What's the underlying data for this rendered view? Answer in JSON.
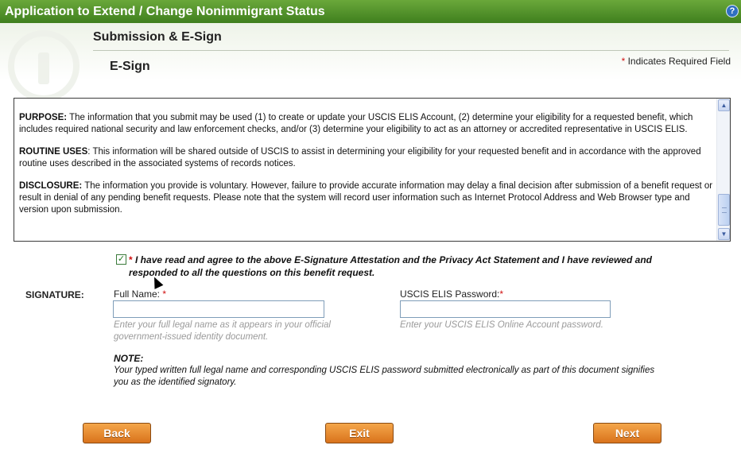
{
  "window": {
    "title": "Application to Extend / Change Nonimmigrant Status",
    "help_glyph": "?"
  },
  "header": {
    "section_title": "Submission & E-Sign",
    "sub_title": "E-Sign",
    "required_star": "*",
    "required_note": "Indicates Required Field"
  },
  "privacy": {
    "paragraphs": [
      {
        "heading": "PURPOSE:",
        "text": " The information that you submit may be used (1) to create or update your USCIS ELIS Account, (2) determine your eligibility for a requested benefit, which includes required national security and law enforcement checks, and/or (3) determine your eligibility to act as an attorney or accredited representative in USCIS ELIS."
      },
      {
        "heading": "ROUTINE USES",
        "text": ": This information will be shared outside of USCIS to assist in determining your eligibility for your requested benefit and in accordance with the approved routine uses described in the associated systems of records notices."
      },
      {
        "heading": "DISCLOSURE:",
        "text": " The information you provide is voluntary. However, failure to provide accurate information may delay a final decision after submission of a benefit request or result in denial of any pending benefit requests. Please note that the system will record user information such as Internet Protocol Address and Web Browser type and version upon submission."
      }
    ]
  },
  "agreement": {
    "checked": true,
    "check_glyph": "✓",
    "star": "*",
    "text": "I have read and agree to the above E-Signature Attestation and the Privacy Act Statement and I have reviewed and responded to all the questions on this benefit request."
  },
  "signature": {
    "label": "SIGNATURE:",
    "full_name": {
      "label": "Full Name:",
      "star": "*",
      "value": "",
      "hint": "Enter your full legal name as it appears in your official government-issued identity document."
    },
    "password": {
      "label": "USCIS ELIS Password:",
      "star": "*",
      "value": "",
      "hint": "Enter your USCIS ELIS Online Account password."
    }
  },
  "note": {
    "title": "NOTE:",
    "text": "Your typed written full legal name and corresponding USCIS ELIS password submitted electronically as part of this document signifies you as the identified signatory."
  },
  "buttons": {
    "back": "Back",
    "exit": "Exit",
    "next": "Next"
  },
  "colors": {
    "title_bar": "#4a8a28",
    "button": "#e88a2e",
    "required": "#d01010"
  }
}
